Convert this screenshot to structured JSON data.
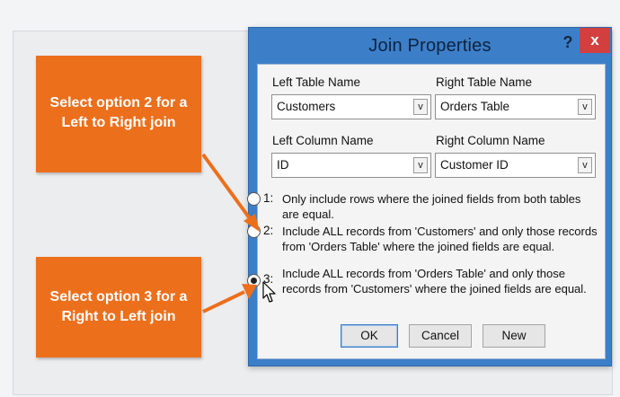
{
  "dialog": {
    "title": "Join Properties",
    "help_label": "?",
    "close_label": "x",
    "left_table_label": "Left Table Name",
    "right_table_label": "Right Table Name",
    "left_table_value": "Customers",
    "right_table_value": "Orders Table",
    "left_column_label": "Left Column Name",
    "right_column_label": "Right Column Name",
    "left_column_value": "ID",
    "right_column_value": "Customer ID",
    "dropdown_glyph": "v",
    "options": [
      {
        "number": "1:",
        "text": "Only include rows where the joined fields from both tables are equal.",
        "selected": false
      },
      {
        "number": "2:",
        "text": "Include ALL records from 'Customers' and only those records from 'Orders Table' where the joined fields are equal.",
        "selected": false
      },
      {
        "number": "3:",
        "text": "Include ALL records from 'Orders Table' and only those records from 'Customers' where the joined fields are equal.",
        "selected": true
      }
    ],
    "buttons": {
      "ok": "OK",
      "cancel": "Cancel",
      "new": "New"
    }
  },
  "callouts": {
    "top": {
      "line1": "Select option 2 for a",
      "line2": "Left to Right join"
    },
    "bottom": {
      "line1": "Select option 3 for a",
      "line2": "Right to Left join"
    }
  },
  "colors": {
    "callout": "#ec6f1c",
    "titlebar": "#3c7fc8",
    "close": "#d33e3e"
  }
}
